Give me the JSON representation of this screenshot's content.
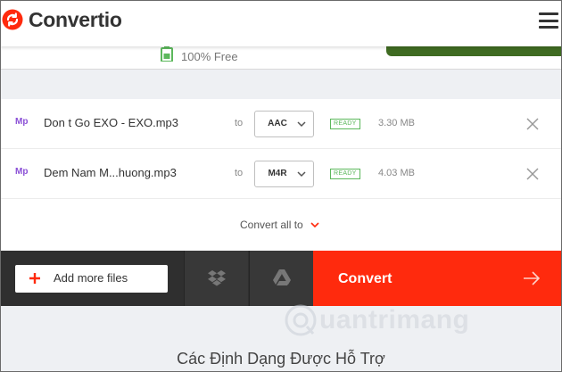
{
  "header": {
    "logo_text": "Convertio",
    "logo_icon": "convertio-arrows-icon",
    "menu_icon": "hamburger-menu-icon",
    "brand_color": "#ff2a0d"
  },
  "promo": {
    "free_text": "100% Free",
    "free_icon": "battery-icon",
    "accent": "#3f6b22"
  },
  "files": [
    {
      "icon_label": "Mp",
      "name": "Don t Go EXO - EXO.mp3",
      "to": "to",
      "format": "AAC",
      "status": "READY",
      "size": "3.30 MB"
    },
    {
      "icon_label": "Mp",
      "name": "Dem Nam M...huong.mp3",
      "to": "to",
      "format": "M4R",
      "status": "READY",
      "size": "4.03 MB"
    }
  ],
  "convert_all": {
    "label": "Convert all to"
  },
  "actions": {
    "add_files": "Add more files",
    "dropbox_icon": "dropbox-icon",
    "gdrive_icon": "google-drive-icon",
    "convert": "Convert",
    "convert_color": "#ff2a0d"
  },
  "watermark": {
    "text": "uantrimang"
  },
  "formats_heading": "Các Định Dạng Được Hỗ Trợ"
}
